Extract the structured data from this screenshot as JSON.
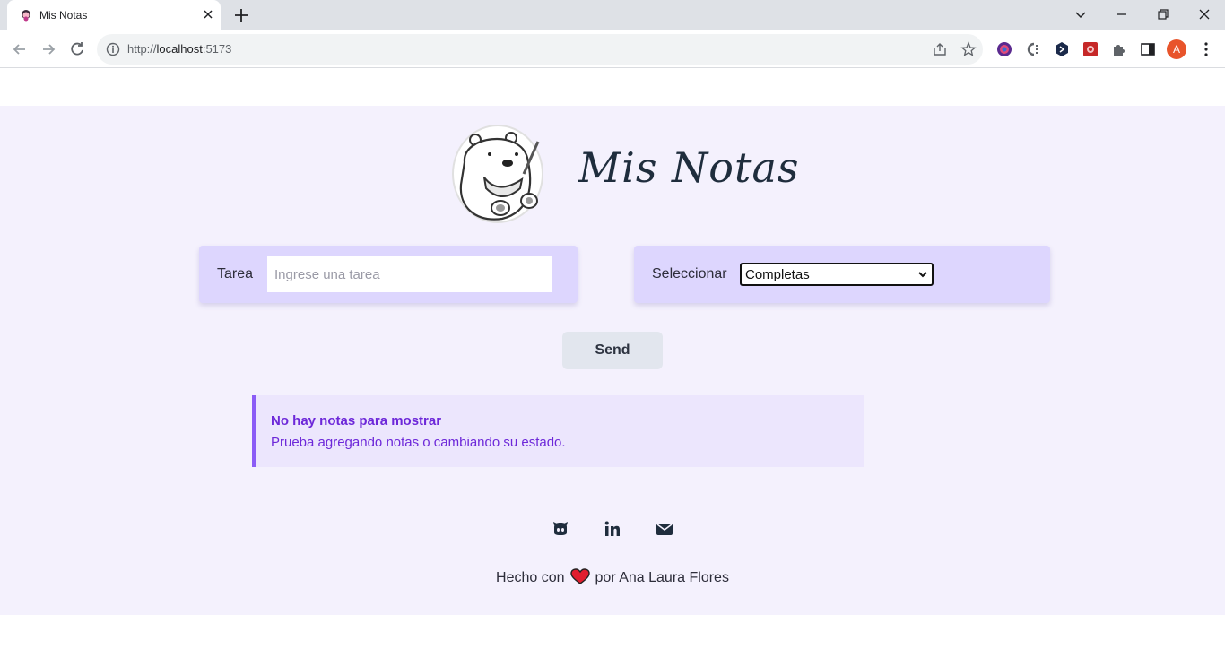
{
  "browser": {
    "tab_title": "Mis Notas",
    "url_scheme": "http://",
    "url_host": "localhost",
    "url_port": ":5173",
    "profile_initial": "A"
  },
  "app": {
    "brand": "Mis Notas",
    "task_label": "Tarea",
    "task_placeholder": "Ingrese una tarea",
    "filter_label": "Seleccionar",
    "filter_value": "Completas",
    "send_label": "Send",
    "empty_title": "No hay notas para mostrar",
    "empty_body": "Prueba agregando notas o cambiando su estado.",
    "footer_prefix": "Hecho con",
    "footer_suffix": "por Ana Laura Flores"
  },
  "colors": {
    "page_bg": "#f4f1fd",
    "card_bg": "#ddd6fe",
    "alert_accent": "#8b5cf6",
    "alert_text": "#6d28d9"
  }
}
